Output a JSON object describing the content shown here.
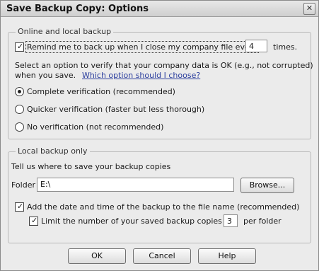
{
  "dialog": {
    "title": "Save Backup Copy: Options",
    "close_label": "✕"
  },
  "online_group": {
    "legend": "Online and local backup",
    "remind_checkbox": {
      "checked": true,
      "label": "Remind me to back up when I close my company file every",
      "value": "4",
      "suffix": "times."
    },
    "verify_prompt_line1": "Select an option to verify that your company data is OK (e.g., not corrupted)",
    "verify_prompt_line2": "when you save.",
    "help_link": "Which option should I choose?",
    "options": [
      {
        "label": "Complete verification (recommended)",
        "selected": true
      },
      {
        "label": "Quicker verification (faster but less thorough)",
        "selected": false
      },
      {
        "label": "No verification (not recommended)",
        "selected": false
      }
    ]
  },
  "local_group": {
    "legend": "Local backup only",
    "instruction": "Tell us where to save your backup copies",
    "folder_label": "Folder",
    "folder_value": "E:\\",
    "browse_label": "Browse...",
    "date_checkbox": {
      "checked": true,
      "label": "Add the date and time of the backup to the file name (recommended)"
    },
    "limit_checkbox": {
      "checked": true,
      "label": "Limit the number of your saved backup copies to",
      "value": "3",
      "suffix": "per folder"
    }
  },
  "footer": {
    "ok_label": "OK",
    "cancel_label": "Cancel",
    "help_label": "Help"
  }
}
